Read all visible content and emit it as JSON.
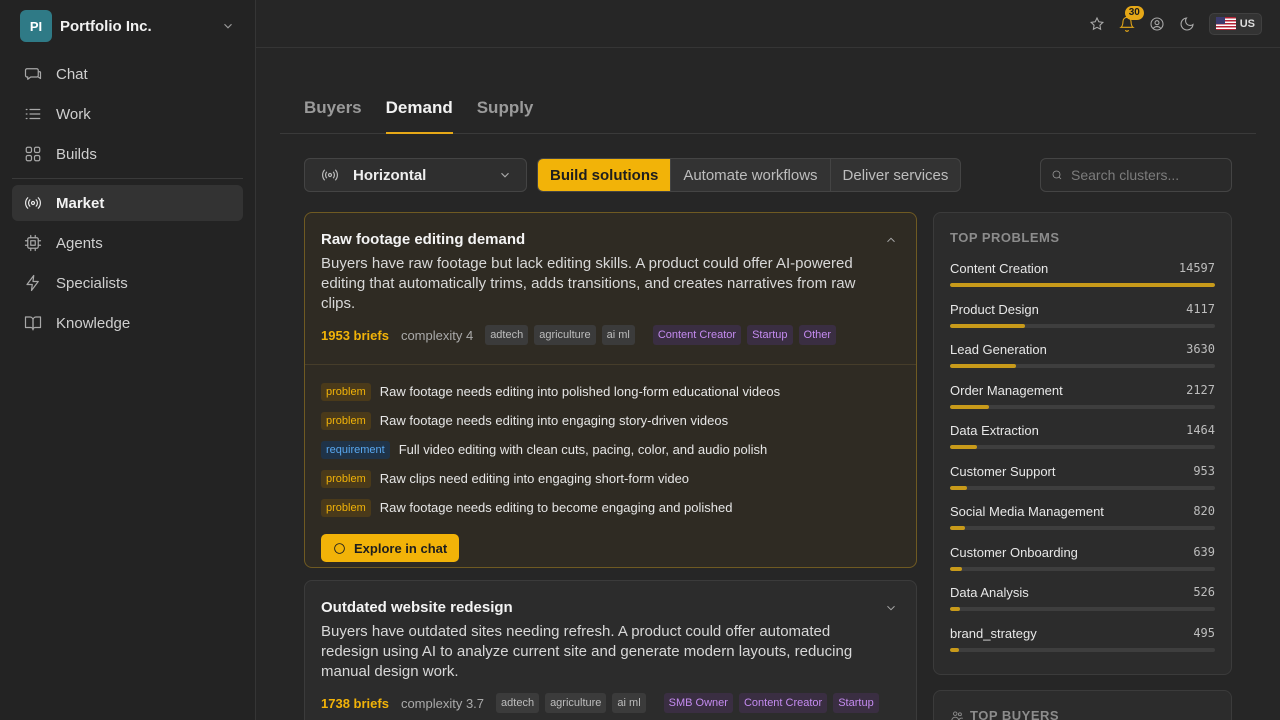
{
  "org": {
    "initials": "PI",
    "name": "Portfolio Inc."
  },
  "nav": {
    "primary": [
      {
        "label": "Chat",
        "icon": "chat-icon"
      },
      {
        "label": "Work",
        "icon": "list-icon"
      },
      {
        "label": "Builds",
        "icon": "grid-icon"
      }
    ],
    "secondary": [
      {
        "label": "Market",
        "icon": "radio-icon",
        "active": true
      },
      {
        "label": "Agents",
        "icon": "cpu-icon"
      },
      {
        "label": "Specialists",
        "icon": "bolt-icon"
      },
      {
        "label": "Knowledge",
        "icon": "book-icon"
      }
    ]
  },
  "topbar": {
    "notifications": "30",
    "locale": "US"
  },
  "tabs": [
    "Buyers",
    "Demand",
    "Supply"
  ],
  "active_tab": "Demand",
  "filters": {
    "select_value": "Horizontal",
    "segments": [
      "Build solutions",
      "Automate workflows",
      "Deliver services"
    ],
    "active_segment": "Build solutions",
    "search_placeholder": "Search clusters..."
  },
  "cards": [
    {
      "title": "Raw footage editing demand",
      "description": "Buyers have raw footage but lack editing skills. A product could offer AI-powered editing that automatically trims, adds transitions, and creates narratives from raw clips.",
      "briefs": "1953 briefs",
      "complexity": "complexity 4",
      "tags": [
        "adtech",
        "agriculture",
        "ai ml"
      ],
      "personas": [
        "Content Creator",
        "Startup",
        "Other"
      ],
      "items": [
        {
          "type": "problem",
          "text": "Raw footage needs editing into polished long-form educational videos"
        },
        {
          "type": "problem",
          "text": "Raw footage needs editing into engaging story-driven videos"
        },
        {
          "type": "requirement",
          "text": "Full video editing with clean cuts, pacing, color, and audio polish"
        },
        {
          "type": "problem",
          "text": "Raw clips need editing into engaging short-form video"
        },
        {
          "type": "problem",
          "text": "Raw footage needs editing to become engaging and polished"
        }
      ],
      "cta": "Explore in chat"
    },
    {
      "title": "Outdated website redesign",
      "description": "Buyers have outdated sites needing refresh. A product could offer automated redesign using AI to analyze current site and generate modern layouts, reducing manual design work.",
      "briefs": "1738 briefs",
      "complexity": "complexity 3.7",
      "tags": [
        "adtech",
        "agriculture",
        "ai ml"
      ],
      "personas": [
        "SMB Owner",
        "Content Creator",
        "Startup"
      ]
    }
  ],
  "top_problems": {
    "title": "TOP PROBLEMS",
    "max": 14597,
    "items": [
      {
        "label": "Content Creation",
        "count": 14597
      },
      {
        "label": "Product Design",
        "count": 4117
      },
      {
        "label": "Lead Generation",
        "count": 3630
      },
      {
        "label": "Order Management",
        "count": 2127
      },
      {
        "label": "Data Extraction",
        "count": 1464
      },
      {
        "label": "Customer Support",
        "count": 953
      },
      {
        "label": "Social Media Management",
        "count": 820
      },
      {
        "label": "Customer Onboarding",
        "count": 639
      },
      {
        "label": "Data Analysis",
        "count": 526
      },
      {
        "label": "brand_strategy",
        "count": 495
      }
    ]
  },
  "top_buyers": {
    "title": "TOP BUYERS"
  }
}
